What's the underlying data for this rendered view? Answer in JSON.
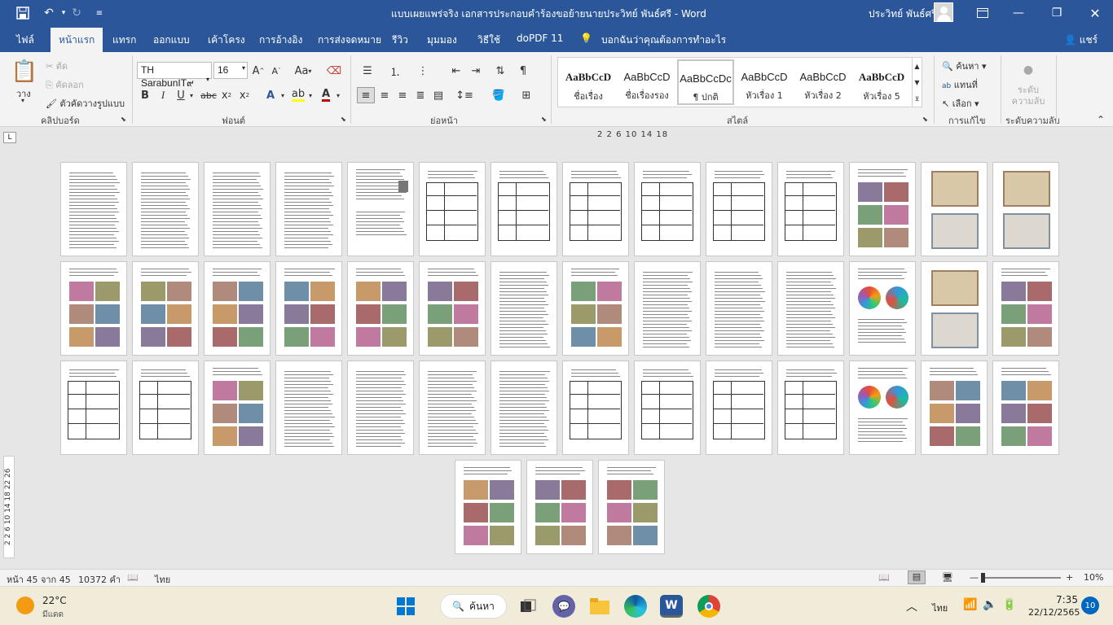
{
  "window": {
    "title": "แบบเผยแพร่จริง เอกสารประกอบคำร้องขอย้ายนายประวิทย์ พันธ์ศรี  -  Word",
    "user": "ประวิทย์ พันธ์ศรี"
  },
  "tabs": [
    "ไฟล์",
    "หน้าแรก",
    "แทรก",
    "ออกแบบ",
    "เค้าโครง",
    "การอ้างอิง",
    "การส่งจดหมาย",
    "รีวิว",
    "มุมมอง",
    "วิธีใช้",
    "doPDF 11"
  ],
  "tell_me": "บอกฉันว่าคุณต้องการทำอะไร",
  "share": "แชร์",
  "clipboard": {
    "paste": "วาง",
    "cut": "ตัด",
    "copy": "คัดลอก",
    "format_painter": "ตัวคัดวางรูปแบบ",
    "label": "คลิปบอร์ด"
  },
  "font": {
    "name": "TH SarabunIT๙",
    "size": "16",
    "label": "ฟอนต์",
    "change_case": "Aa",
    "clear": "A"
  },
  "paragraph": {
    "label": "ย่อหน้า"
  },
  "styles": {
    "label": "สไตล์",
    "items": [
      {
        "sample": "AaBbCcD",
        "name": "ชื่อเรื่อง"
      },
      {
        "sample": "AaBbCcD",
        "name": "ชื่อเรื่องรอง"
      },
      {
        "sample": "AaBbCcDc",
        "name": "¶ ปกติ"
      },
      {
        "sample": "AaBbCcD",
        "name": "หัวเรื่อง 1"
      },
      {
        "sample": "AaBbCcD",
        "name": "หัวเรื่อง 2"
      },
      {
        "sample": "AaBbCcD",
        "name": "หัวเรื่อง 5"
      }
    ]
  },
  "editing": {
    "find": "ค้นหา",
    "replace": "แทนที่",
    "select": "เลือก",
    "label": "การแก้ไข"
  },
  "sensitivity": {
    "button": "ระดับความลับ",
    "label": "ระดับความลับ"
  },
  "ruler": {
    "horizontal": "2  2    6   10  14  18",
    "vertical": "2 2 6 10 14 18 22 26"
  },
  "status": {
    "page": "หน้า 45 จาก 45",
    "words": "10372 คำ",
    "language": "ไทย",
    "zoom": "10%"
  },
  "taskbar": {
    "weather_temp": "22°C",
    "weather_desc": "มีแดด",
    "search": "ค้นหา",
    "lang": "ไทย",
    "time": "7:35",
    "date": "22/12/2565",
    "notifications": "10"
  },
  "colors": {
    "word_blue": "#2b579a",
    "ribbon_bg": "#f3f3f3",
    "accent_red": "#c00000"
  }
}
